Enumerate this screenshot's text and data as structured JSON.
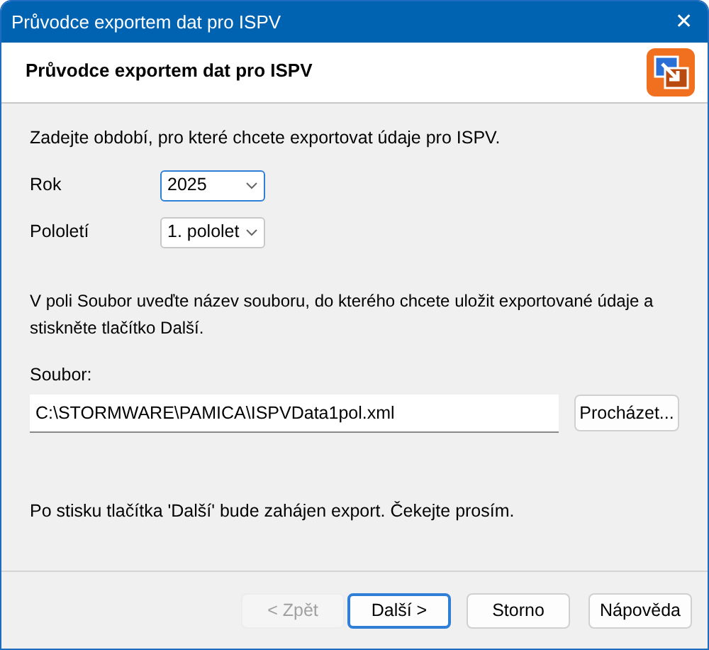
{
  "window": {
    "title": "Průvodce exportem dat pro ISPV",
    "close": "✕"
  },
  "header": {
    "title": "Průvodce exportem dat pro ISPV"
  },
  "intro": "Zadejte období, pro které chcete exportovat údaje pro ISPV.",
  "fields": [
    {
      "label": "Rok",
      "value": "2025",
      "focused": true
    },
    {
      "label": "Pololetí",
      "value": "1. pololet",
      "focused": false
    }
  ],
  "file_note": "V poli Soubor uveďte název souboru, do kterého chcete uložit exportované údaje a stiskněte tlačítko Další.",
  "file": {
    "label": "Soubor:",
    "value": "C:\\STORMWARE\\PAMICA\\ISPVData1pol.xml",
    "browse": "Procházet..."
  },
  "notice": "Po stisku tlačítka 'Další' bude zahájen export. Čekejte prosím.",
  "buttons": [
    {
      "label": "< Zpět",
      "disabled": true,
      "default": false
    },
    {
      "label": "Další >",
      "disabled": false,
      "default": true
    },
    {
      "label": "Storno",
      "disabled": false,
      "default": false
    },
    {
      "label": "Nápověda",
      "disabled": false,
      "default": false
    }
  ]
}
